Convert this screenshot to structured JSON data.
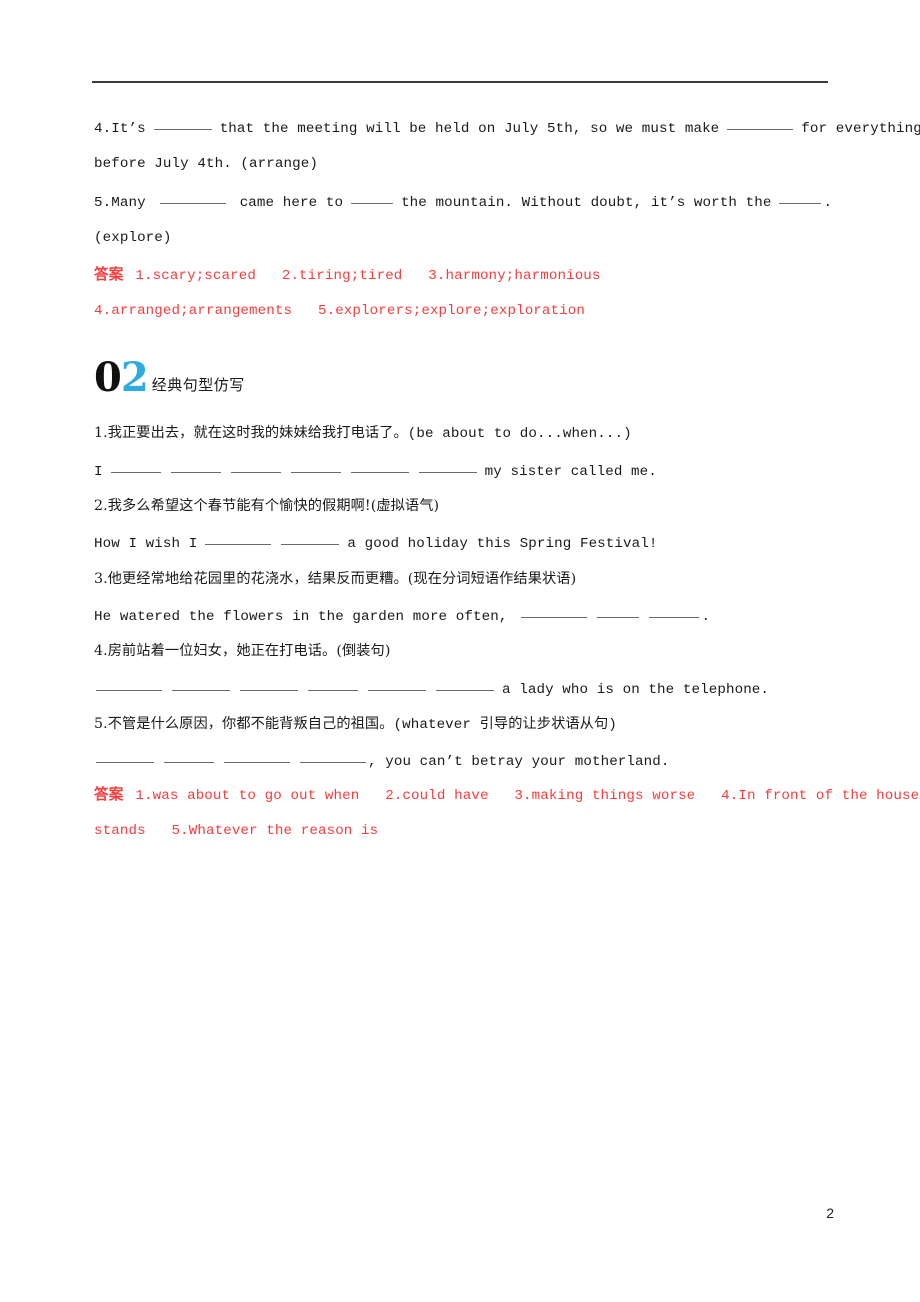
{
  "page": {
    "number": "2",
    "rule": true
  },
  "section_one_tail": {
    "items": [
      {
        "id": "q4",
        "line1_pre": "4.It’s",
        "line1_mid": "that the meeting will be held on July 5th, so we must make",
        "line1_post": "for everything",
        "line2": "before July 4th. (arrange)"
      },
      {
        "id": "q5",
        "line1_pre": "5.Many",
        "line1_mid": "came here to",
        "line1_mid2": "the mountain. Without doubt, it’s worth the",
        "line1_post": ".",
        "line2": "(explore)"
      }
    ],
    "answers": {
      "label": "答案",
      "line1": "1.scary;scared   2.tiring;tired   3.harmony;harmonious",
      "line2": "4.arranged;arrangements   5.explorers;explore;exploration"
    }
  },
  "section_two": {
    "number_prefix": "0",
    "number_suffix": "2",
    "title": "经典句型仿写",
    "items": [
      {
        "id": "s1",
        "prompt_cn": "1.我正要出去，就在这时我的妹妹给我打电话了。",
        "prompt_hint": "(be about to do...when...)",
        "answer_pre": "I",
        "blanks": 6,
        "answer_post": "my sister called me."
      },
      {
        "id": "s2",
        "prompt_cn": "2.我多么希望这个春节能有个愉快的假期啊!",
        "prompt_hint": "(虚拟语气)",
        "answer_pre": "How I wish I",
        "blanks": 2,
        "answer_post": "a good holiday this Spring Festival!"
      },
      {
        "id": "s3",
        "prompt_cn": "3.他更经常地给花园里的花浇水，结果反而更糟。",
        "prompt_hint": "(现在分词短语作结果状语)",
        "answer_pre": "He watered the flowers in the garden more often,",
        "blanks": 3,
        "answer_post": "."
      },
      {
        "id": "s4",
        "prompt_cn": "4.房前站着一位妇女，她正在打电话。",
        "prompt_hint": "(倒装句)",
        "answer_pre": "",
        "blanks": 6,
        "answer_post": "a lady who is on the telephone."
      },
      {
        "id": "s5",
        "prompt_cn": "5.不管是什么原因，你都不能背叛自己的祖国。",
        "prompt_hint": "(whatever 引导的让步状语从句)",
        "answer_pre": "",
        "blanks": 4,
        "answer_post": ", you can’t betray your motherland."
      }
    ],
    "answers": {
      "label": "答案",
      "line1": "1.was about to go out when   2.could have   3.making things worse   4.In front of the house",
      "line2": "stands   5.Whatever the reason is"
    }
  },
  "colors": {
    "answer_red": "#fb3b3b",
    "accent_blue": "#2cacdf",
    "text": "#1a1a1a",
    "blank_rule": "#6a6a6a"
  }
}
